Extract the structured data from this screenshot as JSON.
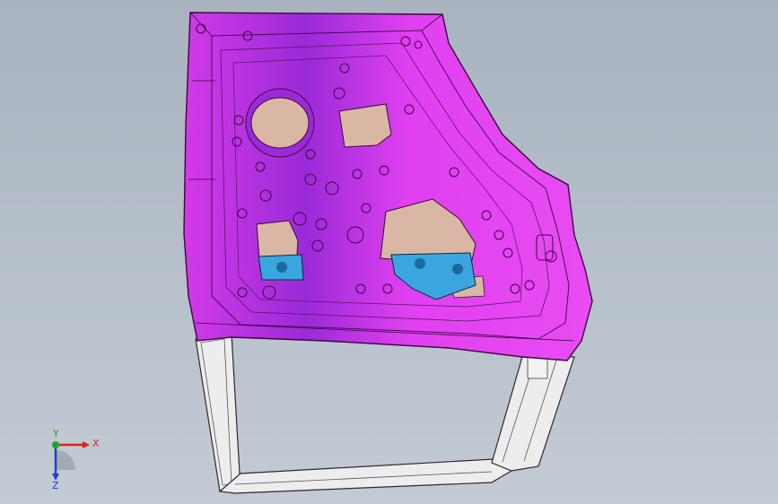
{
  "viewport": {
    "background_top": "#a9b3bf",
    "background_bottom": "#c3cbd4"
  },
  "model": {
    "panel_color": "#e040f0",
    "panel_dark": "#9a2ad8",
    "opening_color": "#d9b7a4",
    "bracket_color": "#3aa6e0",
    "frame_color": "#ececec"
  },
  "triad": {
    "x_label": "X",
    "y_label": "Y",
    "z_label": "Z",
    "x_color": "#e0201c",
    "y_color": "#1fa33a",
    "z_color": "#2040d0"
  }
}
